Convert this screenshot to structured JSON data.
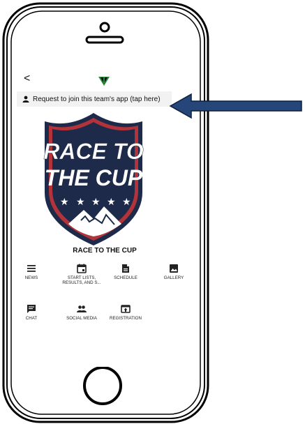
{
  "header": {
    "back_label": "<",
    "request_text": "Request to join this team's app (tap here)"
  },
  "team": {
    "name": "RACE TO THE CUP",
    "badge_line1": "RACE TO",
    "badge_line2": "THE CUP"
  },
  "menu": [
    {
      "label": "NEWS",
      "icon": "news-icon"
    },
    {
      "label": "START LISTS, RESULTS, AND S...",
      "icon": "calendar-icon"
    },
    {
      "label": "SCHEDULE",
      "icon": "document-icon"
    },
    {
      "label": "GALLERY",
      "icon": "gallery-icon"
    },
    {
      "label": "CHAT",
      "icon": "chat-icon"
    },
    {
      "label": "SOCIAL MEDIA",
      "icon": "people-icon"
    },
    {
      "label": "REGISTRATION",
      "icon": "registration-icon"
    }
  ],
  "colors": {
    "navy": "#1e2a4a",
    "red": "#b2343a",
    "arrow": "#26467a",
    "brand_green": "#2c8a3e"
  }
}
